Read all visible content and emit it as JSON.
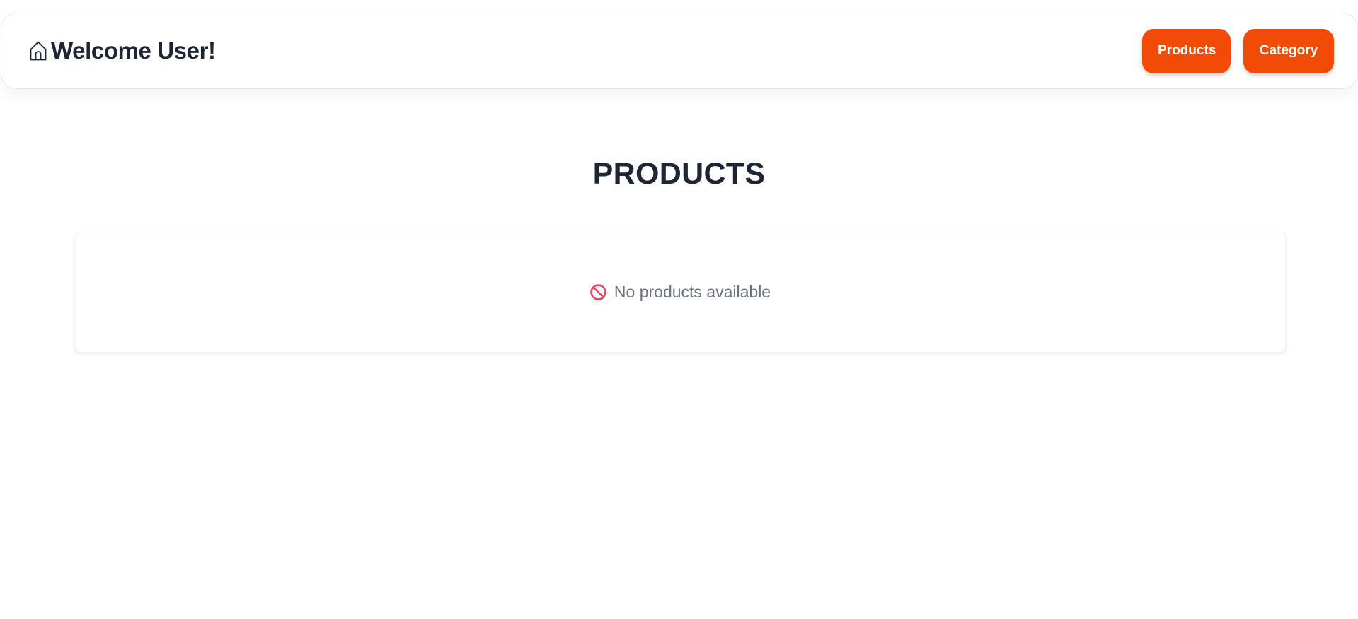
{
  "header": {
    "icon": "home-icon",
    "welcome_text": "Welcome User!"
  },
  "nav": {
    "products_label": "Products",
    "category_label": "Category"
  },
  "main": {
    "title": "PRODUCTS",
    "empty_icon": "ban-icon",
    "empty_message": "No products available"
  },
  "colors": {
    "accent": "#f24b08",
    "heading": "#1e2535",
    "muted_text": "#6b7280",
    "empty_icon": "#f43f5e"
  }
}
